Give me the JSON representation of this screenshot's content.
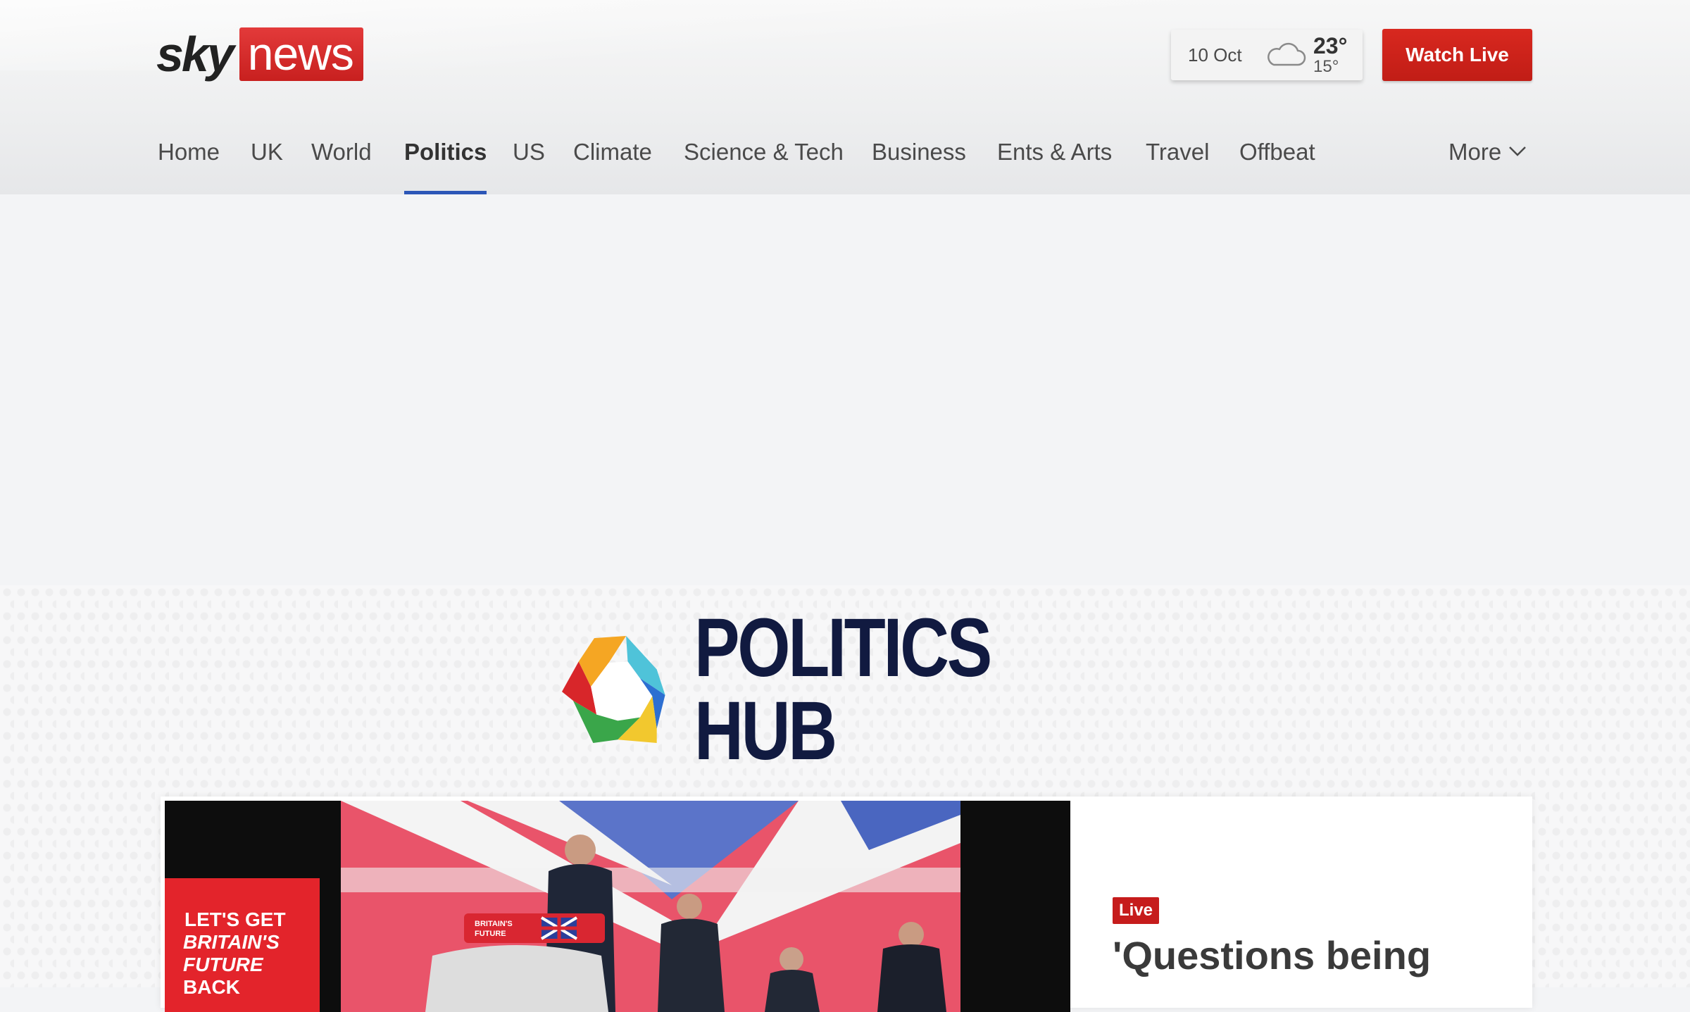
{
  "brand": {
    "sky": "sky",
    "news": "news"
  },
  "weather": {
    "date": "10 Oct",
    "icon": "cloud-icon",
    "high": "23°",
    "low": "15°"
  },
  "watch_live": {
    "label": "Watch Live",
    "color": "#c8211a"
  },
  "nav": {
    "items": [
      {
        "label": "Home"
      },
      {
        "label": "UK"
      },
      {
        "label": "World"
      },
      {
        "label": "Politics",
        "active": true
      },
      {
        "label": "US"
      },
      {
        "label": "Climate"
      },
      {
        "label": "Science & Tech"
      },
      {
        "label": "Business"
      },
      {
        "label": "Ents & Arts"
      },
      {
        "label": "Travel"
      },
      {
        "label": "Offbeat"
      }
    ],
    "more_label": "More",
    "active_color": "#2c56b7"
  },
  "hub": {
    "title": "POLITICS HUB",
    "logo_colors": [
      "#2d6fd1",
      "#f2c82e",
      "#3aa64a",
      "#d8262a",
      "#f5a623",
      "#4fc3d9"
    ]
  },
  "lead_story": {
    "badge": "Live",
    "headline": "'Questions being",
    "image": {
      "sign_text": [
        "LET'S GET",
        "BRITAIN'S",
        "FUTURE",
        "BACK"
      ],
      "lectern_text": [
        "BRITAIN'S",
        "FUTURE"
      ]
    }
  }
}
